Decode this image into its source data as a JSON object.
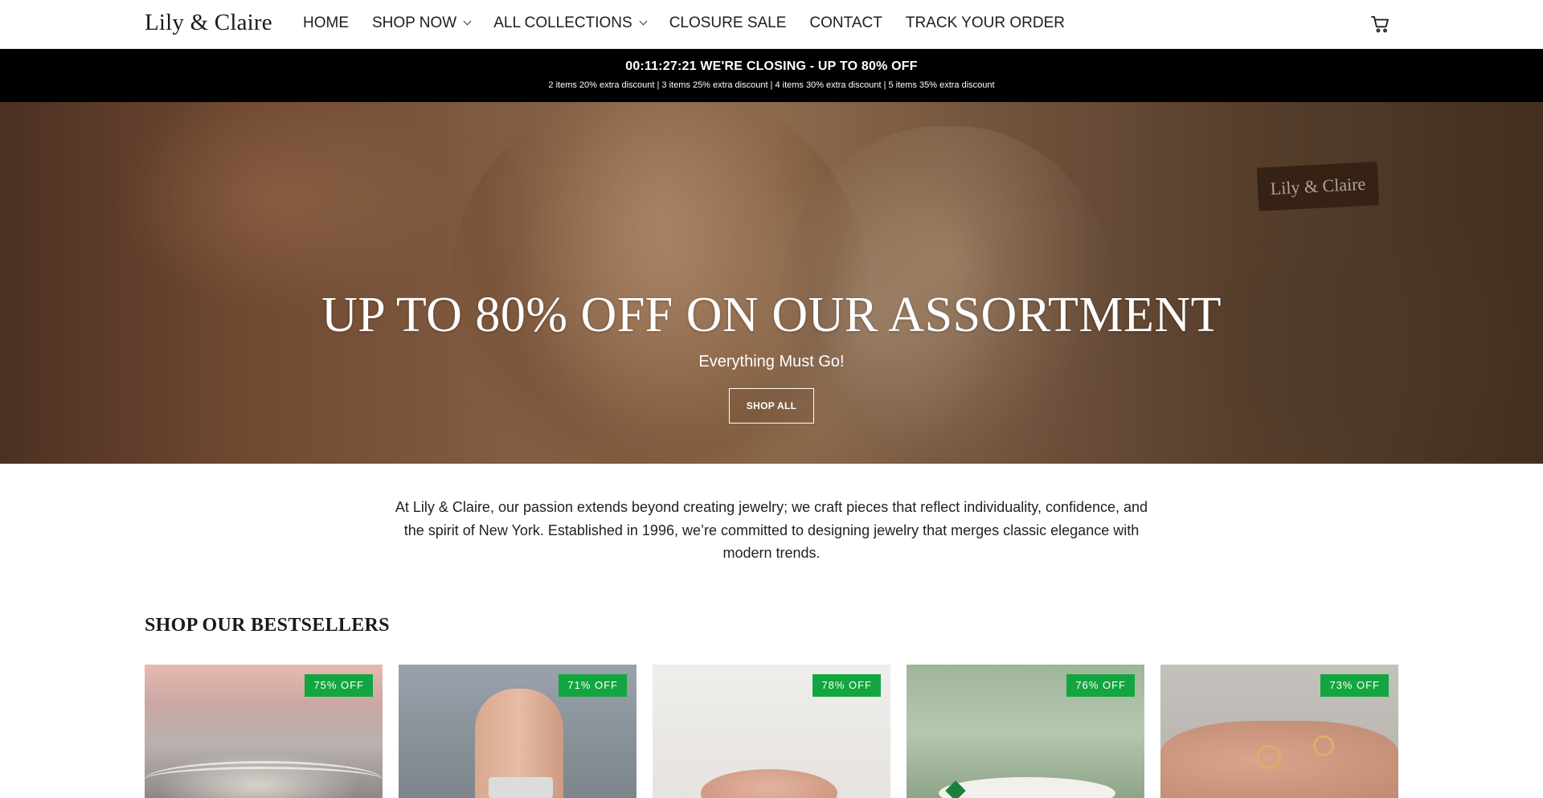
{
  "header": {
    "logo": "Lily & Claire",
    "nav": [
      {
        "label": "HOME",
        "dropdown": false
      },
      {
        "label": "SHOP NOW",
        "dropdown": true
      },
      {
        "label": "ALL COLLECTIONS",
        "dropdown": true
      },
      {
        "label": "CLOSURE SALE",
        "dropdown": false
      },
      {
        "label": "CONTACT",
        "dropdown": false
      },
      {
        "label": "TRACK YOUR ORDER",
        "dropdown": false
      }
    ],
    "cart_icon": "cart-icon"
  },
  "announcement": {
    "title": "00:11:27:21 WE'RE CLOSING - UP TO 80% OFF",
    "subtitle": "2 items 20% extra discount | 3 items 25% extra discount | 4 items 30% extra discount | 5 items 35% extra discount",
    "background": "#000000"
  },
  "hero": {
    "sign_text": "Lily & Claire",
    "title": "UP TO 80% OFF ON OUR ASSORTMENT",
    "subtitle": "Everything Must Go!",
    "button": "SHOP ALL"
  },
  "intro": {
    "text": "At Lily & Claire, our passion extends beyond creating jewelry; we craft pieces that reflect individuality, confidence, and the spirit of New York. Established in 1996, we’re committed to designing jewelry that merges classic elegance with modern trends."
  },
  "bestsellers": {
    "title": "SHOP OUR BESTSELLERS",
    "badge_color": "#13a640",
    "products": [
      {
        "badge": "75% OFF"
      },
      {
        "badge": "71% OFF"
      },
      {
        "badge": "78% OFF"
      },
      {
        "badge": "76% OFF"
      },
      {
        "badge": "73% OFF"
      }
    ]
  }
}
